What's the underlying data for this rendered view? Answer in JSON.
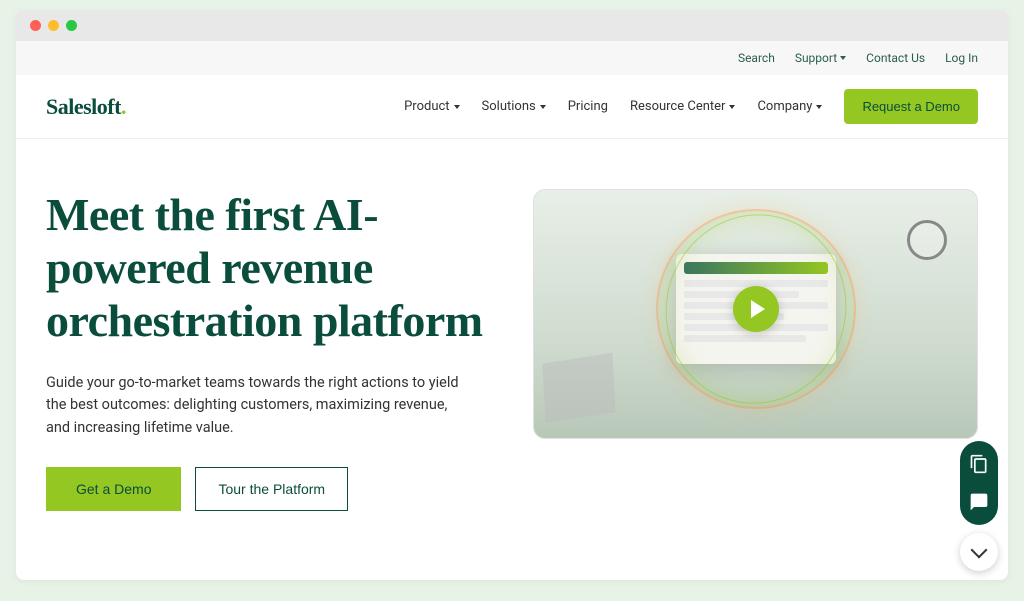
{
  "brand": {
    "name": "Salesloft",
    "dot": "."
  },
  "topbar": {
    "search": "Search",
    "support": "Support",
    "contact": "Contact Us",
    "login": "Log In"
  },
  "nav": {
    "product": "Product",
    "solutions": "Solutions",
    "pricing": "Pricing",
    "resource": "Resource Center",
    "company": "Company",
    "demo": "Request a Demo"
  },
  "hero": {
    "title": "Meet the first AI-powered revenue orchestration platform",
    "subtitle": "Guide your go-to-market teams towards the right actions to yield the best outcomes: delighting customers, maximizing revenue, and increasing lifetime value.",
    "cta_primary": "Get a Demo",
    "cta_secondary": "Tour the Platform"
  },
  "colors": {
    "brand_green": "#0a4d3c",
    "accent_lime": "#94c722",
    "bg_mint": "#e8f3e8"
  }
}
